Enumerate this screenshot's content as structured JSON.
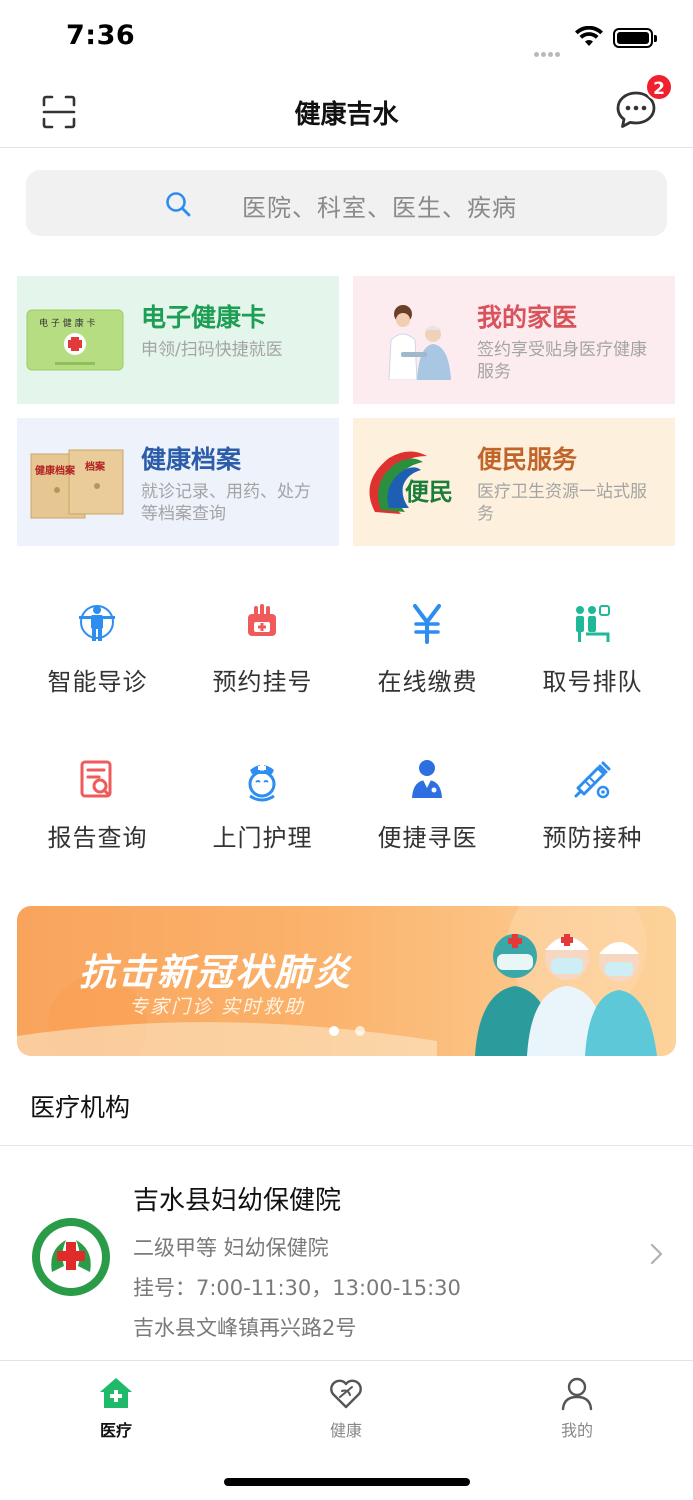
{
  "status_bar": {
    "time": "7:36"
  },
  "nav": {
    "title": "健康吉水",
    "message_badge": "2"
  },
  "search": {
    "placeholder": "医院、科室、医生、疾病"
  },
  "cards": [
    {
      "title": "电子健康卡",
      "desc": "申领/扫码快捷就医",
      "title_color": "#1e9d55",
      "bg": "#e4f6ec",
      "icon": "health-card-icon"
    },
    {
      "title": "我的家医",
      "desc": "签约享受贴身医疗健康服务",
      "title_color": "#d9535c",
      "bg": "#fdecef",
      "icon": "family-doctor-icon"
    },
    {
      "title": "健康档案",
      "desc": "就诊记录、用药、处方等档案查询",
      "title_color": "#2d5da8",
      "bg": "#edf2fb",
      "icon": "health-archive-icon"
    },
    {
      "title": "便民服务",
      "desc": "医疗卫生资源一站式服务",
      "title_color": "#c0642a",
      "bg": "#fdf0dc",
      "icon": "convenience-service-icon"
    }
  ],
  "grid": [
    {
      "label": "智能导诊",
      "icon": "smart-guide-icon"
    },
    {
      "label": "预约挂号",
      "icon": "appointment-icon"
    },
    {
      "label": "在线缴费",
      "icon": "yen-icon"
    },
    {
      "label": "取号排队",
      "icon": "queue-icon"
    },
    {
      "label": "报告查询",
      "icon": "report-icon"
    },
    {
      "label": "上门护理",
      "icon": "nurse-icon"
    },
    {
      "label": "便捷寻医",
      "icon": "doctor-icon"
    },
    {
      "label": "预防接种",
      "icon": "vaccine-icon"
    }
  ],
  "banner": {
    "title": "抗击新冠状肺炎",
    "subtitle": "专家门诊  实时救助",
    "active_dot": 0
  },
  "section": {
    "title": "医疗机构"
  },
  "hospital": {
    "name": "吉水县妇幼保健院",
    "level": "二级甲等 妇幼保健院",
    "hours": "挂号：7:00-11:30，13:00-15:30",
    "address": "吉水县文峰镇再兴路2号"
  },
  "tabs": [
    {
      "label": "医疗",
      "icon": "home-plus-icon",
      "active": true
    },
    {
      "label": "健康",
      "icon": "heart-icon",
      "active": false
    },
    {
      "label": "我的",
      "icon": "user-icon",
      "active": false
    }
  ],
  "colors": {
    "accent_green": "#1fb96a",
    "accent_blue": "#2d8ef0",
    "accent_red": "#f0202e"
  }
}
